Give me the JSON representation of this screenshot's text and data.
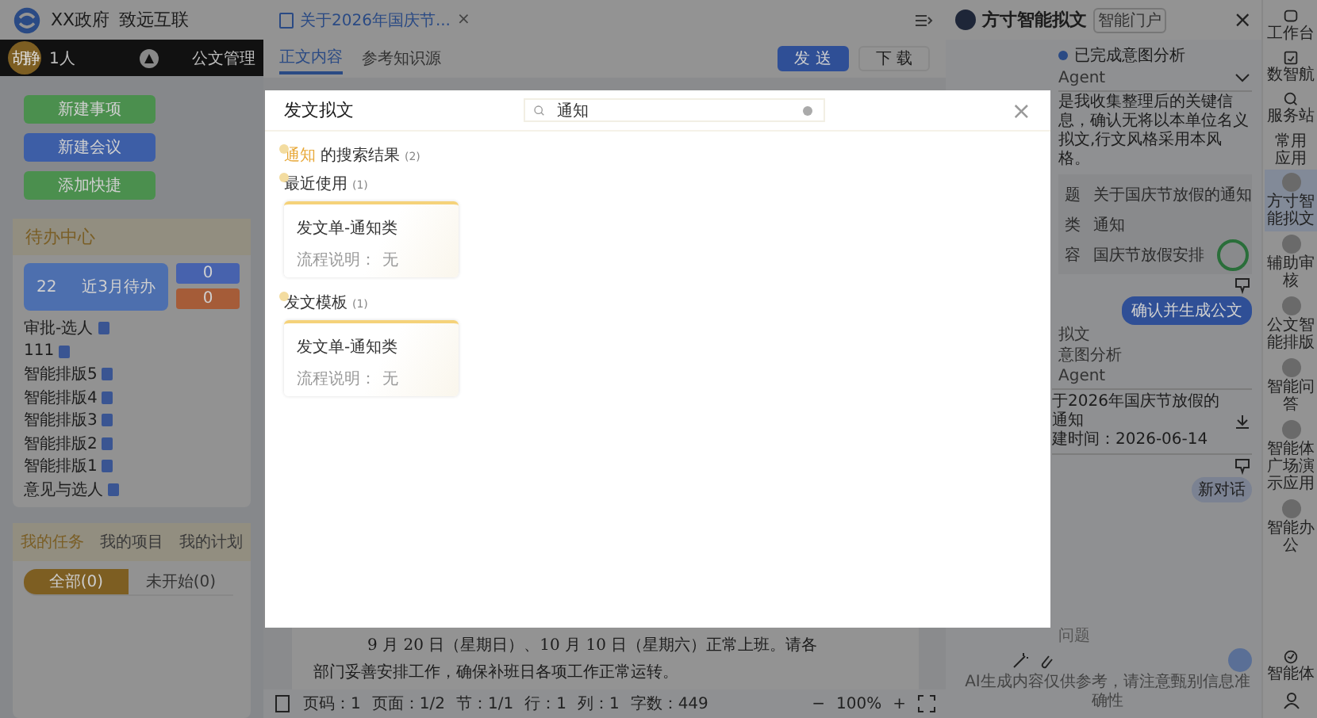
{
  "app": {
    "org": "XX政府",
    "brand": "致远互联"
  },
  "user_bar": {
    "avatar": "胡静",
    "count": "1人",
    "menu": "公文管理"
  },
  "quick_actions": [
    {
      "label": "新建事项",
      "color": "#4b8f4e"
    },
    {
      "label": "新建会议",
      "color": "#3d5ea6"
    },
    {
      "label": "添加快捷",
      "color": "#4b8f4e"
    }
  ],
  "todo": {
    "title": "待办中心",
    "main_count": "22",
    "main_label": "近3月待办",
    "counts": [
      {
        "value": "0",
        "color": "#4762ad"
      },
      {
        "value": "0",
        "color": "#a55c38"
      }
    ],
    "items": [
      "审批-选人",
      "111",
      "智能排版5",
      "智能排版4",
      "智能排版3",
      "智能排版2",
      "智能排版1",
      "意见与选人"
    ]
  },
  "tasks": {
    "tabs": [
      {
        "label": "我的任务",
        "selected": true
      },
      {
        "label": "我的项目",
        "selected": false
      },
      {
        "label": "我的计划",
        "selected": false
      }
    ],
    "filters": [
      {
        "label": "全部(0)",
        "selected": true
      },
      {
        "label": "未开始(0)",
        "selected": false
      }
    ]
  },
  "document": {
    "tab_title": "关于2026年国庆节...",
    "tab_close": "×",
    "tabs": [
      {
        "label": "正文内容",
        "selected": true
      },
      {
        "label": "参考知识源",
        "selected": false
      }
    ],
    "buttons": [
      {
        "label": "发 送",
        "kind": "primary"
      },
      {
        "label": "下 载",
        "kind": "default"
      }
    ],
    "lines": [
      "9 月 20 日（星期日）、10 月 10 日（星期六）正常上班。请各",
      "部门妥善安排工作，确保补班日各项工作正常运转。"
    ],
    "status": [
      "页码：1",
      "页面：1/2",
      "节：1/1",
      "行：1",
      "列：1",
      "字数：449"
    ],
    "zoom": "100%",
    "zoom_out": "−",
    "zoom_in": "+"
  },
  "assistant": {
    "title": "方寸智能拟文",
    "portal": "智能门户",
    "close": "×",
    "status": "已完成意图分析",
    "agent": "Agent",
    "message": "是我收集整理后的关键信息，确认无将以本单位名义拟文,行文风格采用本风格。",
    "fields": [
      {
        "label": "题",
        "value": "关于国庆节放假的通知"
      },
      {
        "label": "类",
        "value": "通知"
      },
      {
        "label": "容",
        "value": "国庆节放假安排"
      }
    ],
    "confirm_button": "确认并生成公文",
    "history_title": "拟文",
    "history_status": "意图分析",
    "history_agent": "Agent",
    "file": {
      "name": "于2026年国庆节放假的通知",
      "time": "建时间：2026-06-14"
    },
    "new_chat": "新对话",
    "input_placeholder": "问题",
    "footer": "AI生成内容仅供参考，请注意甄别信息准确性"
  },
  "rail": {
    "top": [
      {
        "label": "工作台",
        "kind": "home"
      },
      {
        "label": "数智航",
        "kind": "calendar"
      },
      {
        "label": "服务站",
        "kind": "search"
      }
    ],
    "section": "常用应用",
    "apps": [
      {
        "label": "方寸智能拟文",
        "selected": true
      },
      {
        "label": "辅助审核",
        "selected": false
      },
      {
        "label": "公文智能排版",
        "selected": false
      },
      {
        "label": "智能问答",
        "selected": false
      },
      {
        "label": "智能体广场演示应用",
        "selected": false
      },
      {
        "label": "智能办公",
        "selected": false
      }
    ],
    "bottom": "智能体"
  },
  "modal": {
    "title": "发文拟文",
    "close": "×",
    "search_value": "通知",
    "query": "通知",
    "results_label": "的搜索结果",
    "results_count": "(2)",
    "sections": [
      {
        "title": "最近使用",
        "count": "(1)",
        "cards": [
          {
            "title": "发文单-通知类",
            "desc_label": "流程说明：",
            "desc_value": "无"
          }
        ]
      },
      {
        "title": "发文模板",
        "count": "(1)",
        "cards": [
          {
            "title": "发文单-通知类",
            "desc_label": "流程说明：",
            "desc_value": "无"
          }
        ]
      }
    ]
  }
}
